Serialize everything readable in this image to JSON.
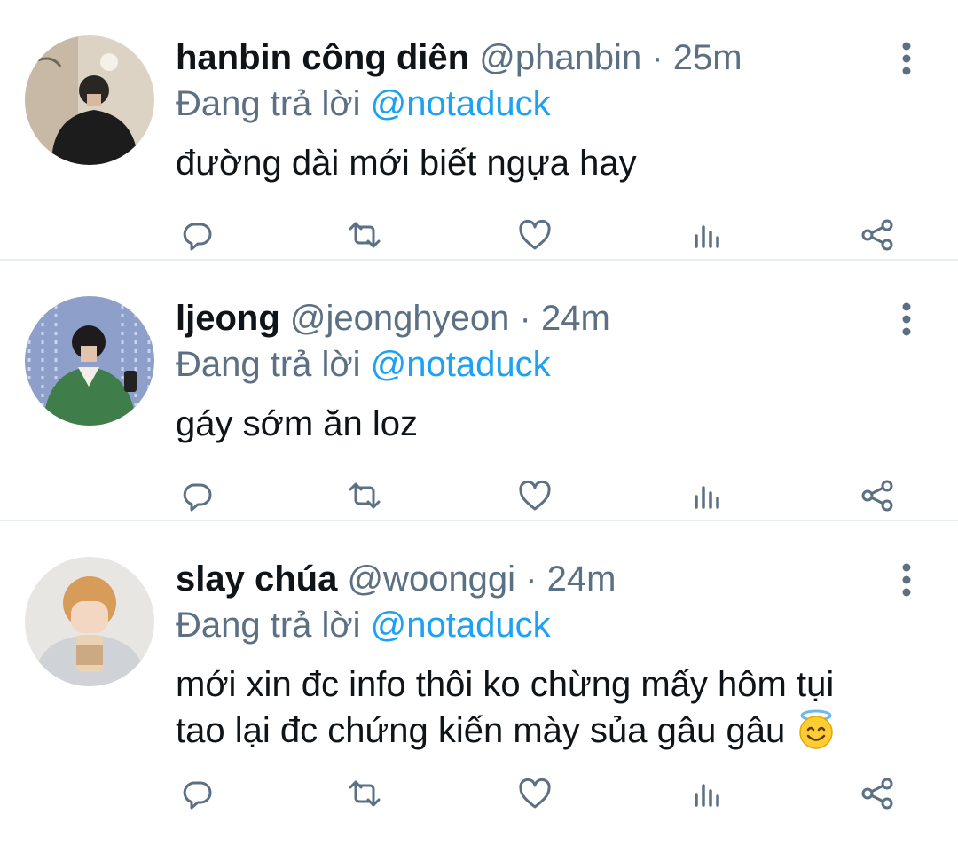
{
  "replying_prefix": "Đang trả lời",
  "tweets": [
    {
      "name": "hanbin công diên",
      "handle": "@phanbin",
      "dot": "·",
      "time": "25m",
      "mention": "@notaduck",
      "text": "đường dài mới biết ngựa hay"
    },
    {
      "name": "ljeong",
      "handle": "@jeonghyeon",
      "dot": "·",
      "time": "24m",
      "mention": "@notaduck",
      "text": "gáy sớm ăn loz"
    },
    {
      "name": "slay chúa",
      "handle": "@woonggi",
      "dot": "·",
      "time": "24m",
      "mention": "@notaduck",
      "text_line1": "mới xin đc info thôi ko chừng mấy hôm tụi",
      "text_line2": "tao lại đc chứng kiến mày sủa gâu gâu",
      "emoji": "smiling-face-with-halo"
    }
  ],
  "icons": {
    "reply": "reply-icon",
    "retweet": "retweet-icon",
    "like": "like-icon",
    "stats": "stats-icon",
    "share": "share-icon",
    "more": "more-icon"
  },
  "colors": {
    "mention": "#1da1f2",
    "secondary_text": "#5b7083",
    "icon": "#5b7083",
    "divider": "#e6ecf0"
  }
}
